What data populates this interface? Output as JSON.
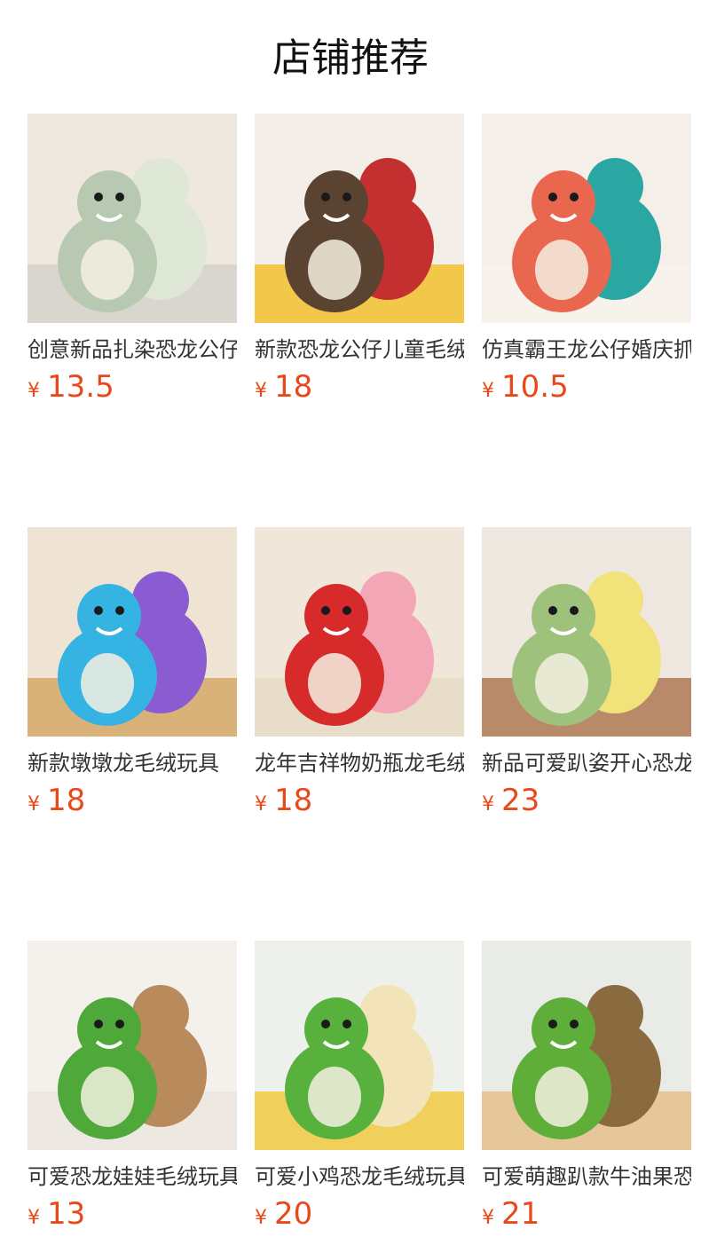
{
  "header": {
    "title": "店铺推荐"
  },
  "currency_symbol": "¥",
  "products": [
    {
      "name": "创意新品扎染恐龙公仔",
      "price": "13.5",
      "bg": "#efe8df",
      "toy": "#b8c9b1",
      "toy2": "#dfe7d6",
      "floor": "#d9d5cf"
    },
    {
      "name": "新款恐龙公仔儿童毛绒",
      "price": "18",
      "bg": "#f3efe8",
      "toy": "#5b4332",
      "toy2": "#c43030",
      "floor": "#f2c84b"
    },
    {
      "name": "仿真霸王龙公仔婚庆抓",
      "price": "10.5",
      "bg": "#f5efe9",
      "toy": "#e9674f",
      "toy2": "#2aa7a3",
      "floor": "#f7f3ec"
    },
    {
      "name": "新款墩墩龙毛绒玩具",
      "price": "18",
      "bg": "#efe3d3",
      "toy": "#35b3e3",
      "toy2": "#8a5bd1",
      "floor": "#d8b279"
    },
    {
      "name": "龙年吉祥物奶瓶龙毛绒",
      "price": "18",
      "bg": "#f0e6da",
      "toy": "#d72a2a",
      "toy2": "#f3a7b6",
      "floor": "#e8ddc9"
    },
    {
      "name": "新品可爱趴姿开心恐龙",
      "price": "23",
      "bg": "#efe8e1",
      "toy": "#9ec27c",
      "toy2": "#f2e27a",
      "floor": "#b98a6a"
    },
    {
      "name": "可爱恐龙娃娃毛绒玩具",
      "price": "13",
      "bg": "#f4f1ec",
      "toy": "#4ea83a",
      "toy2": "#b88a5c",
      "floor": "#ede9e2"
    },
    {
      "name": "可爱小鸡恐龙毛绒玩具",
      "price": "20",
      "bg": "#eef0ec",
      "toy": "#58b13c",
      "toy2": "#f2e4b8",
      "floor": "#f0d05a"
    },
    {
      "name": "可爱萌趣趴款牛油果恐",
      "price": "21",
      "bg": "#e9ece6",
      "toy": "#5fae3a",
      "toy2": "#8a6a3f",
      "floor": "#e6c79a"
    }
  ]
}
